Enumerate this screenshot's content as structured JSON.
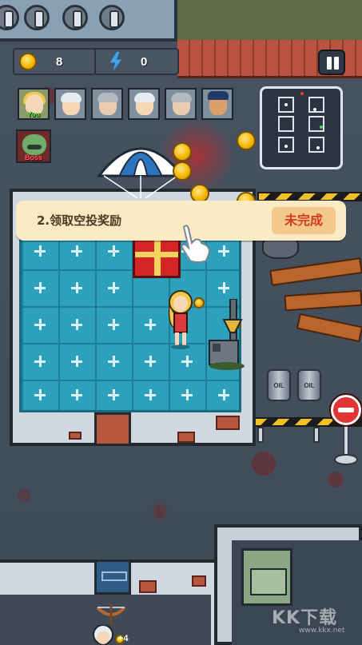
{
  "resources": {
    "coins": "8",
    "energy": "0"
  },
  "portraits": {
    "you_tag": "You",
    "boss_tag": "Boss"
  },
  "task": {
    "text": "2.领取空投奖励",
    "status": "未完成"
  },
  "barrels": {
    "label": "OIL"
  },
  "player_bottom": {
    "tag": "+4"
  },
  "watermark": {
    "main": "KK下载",
    "sub": "www.kkx.net"
  },
  "colors": {
    "task_banner_bg": "#fbebc4",
    "task_status_text": "#d43a1f",
    "coin": "#f4b400",
    "energy": "#3fa4f0",
    "room_floor": "#2da0bc"
  },
  "icons": {
    "coin": "coin-icon",
    "energy": "lightning-icon",
    "pause": "pause-icon",
    "pointer": "pointing-hand-icon",
    "stop": "stop-sign-icon"
  }
}
